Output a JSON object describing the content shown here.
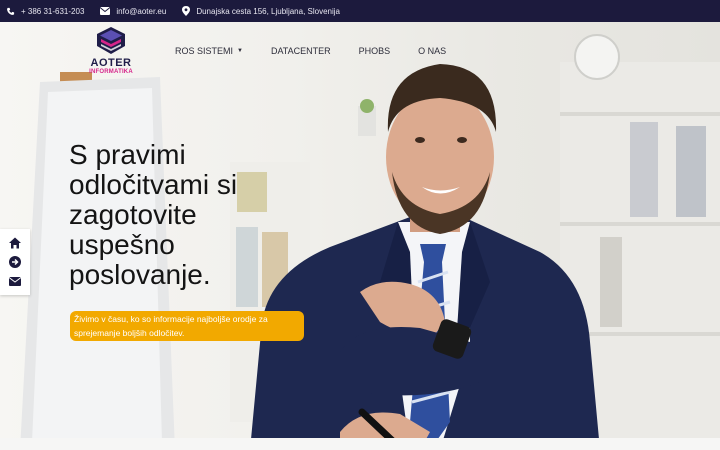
{
  "topbar": {
    "phone": "+ 386 31-631-203",
    "email": "info@aoter.eu",
    "address": "Dunajska cesta 156, Ljubljana, Slovenija"
  },
  "logo": {
    "brand": "AOTER",
    "sub": "INFORMATIKA"
  },
  "nav": {
    "items": [
      {
        "label": "ROS SISTEMI",
        "has_dropdown": true
      },
      {
        "label": "DATACENTER"
      },
      {
        "label": "PHOBS"
      },
      {
        "label": "O NAS"
      }
    ]
  },
  "hero": {
    "headline_lines": [
      "S pravimi",
      "odločitvami si",
      "zagotovite",
      "uspešno",
      "poslovanje."
    ],
    "sub_line1": "Živimo v času, ko so informacije najboljše orodje za",
    "sub_line2": "sprejemanje boljših odločitev."
  },
  "side_icons": [
    "home-icon",
    "arrow-circle-right-icon",
    "envelope-icon"
  ],
  "colors": {
    "topbar_bg": "#1c1a3d",
    "accent": "#f2a900",
    "brand_navy": "#1f1d49",
    "brand_pink": "#d6258a"
  }
}
